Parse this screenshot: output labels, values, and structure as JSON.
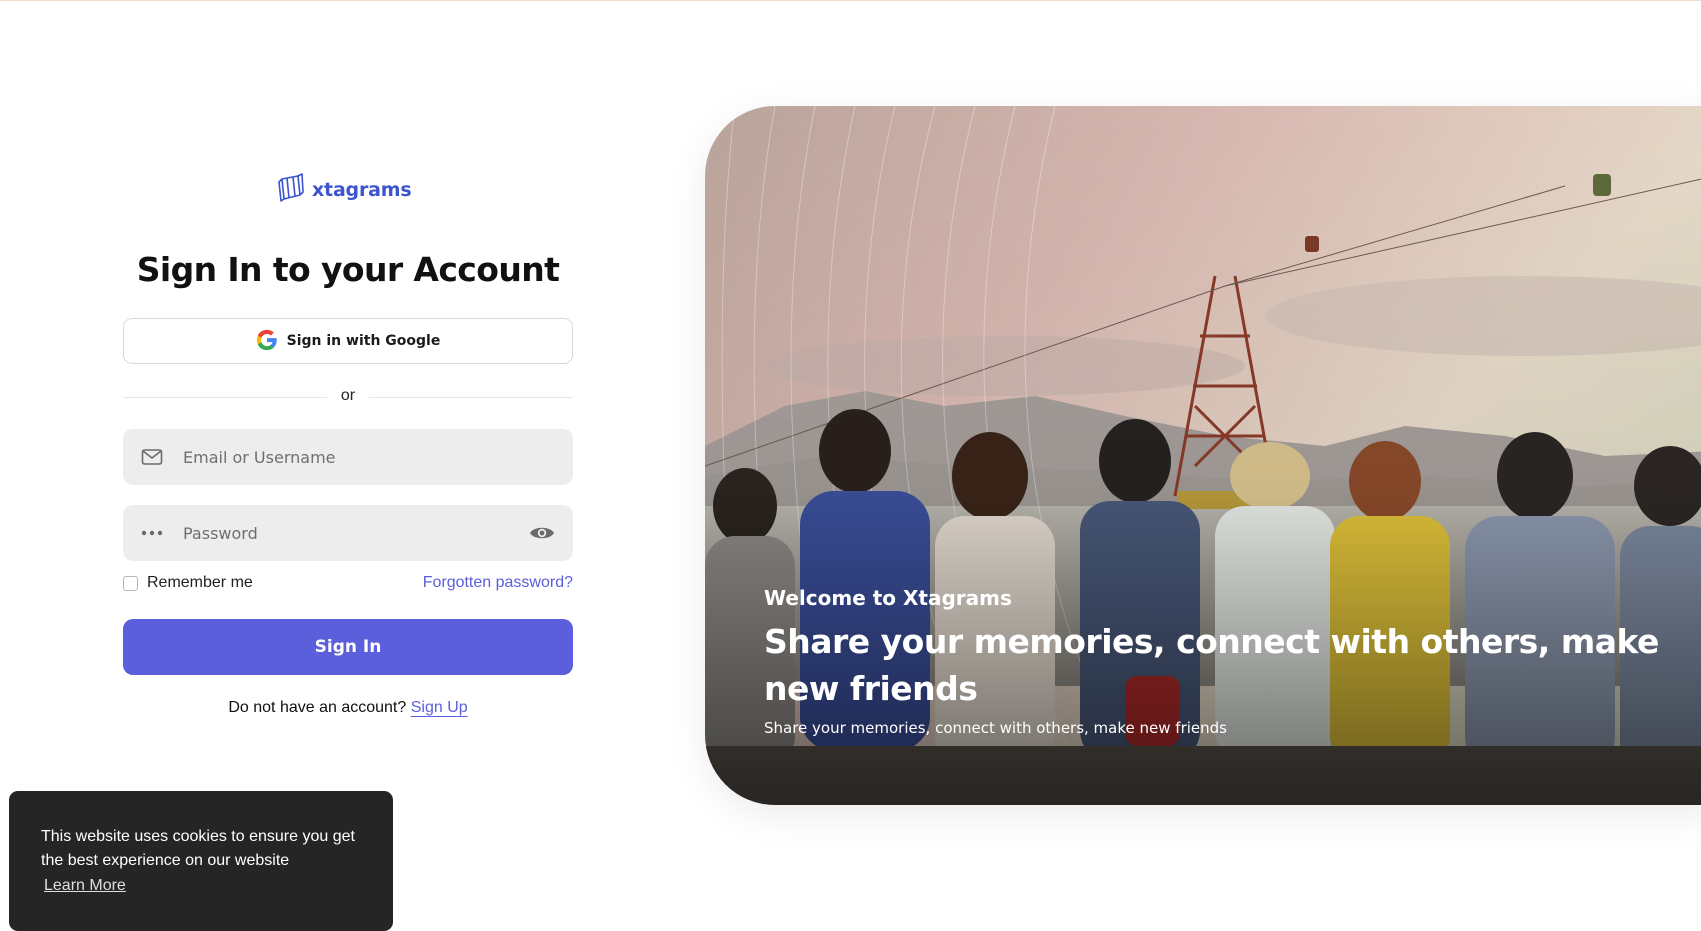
{
  "brand": {
    "name": "xtagrams",
    "logo_icon": "xtagrams-logo-icon"
  },
  "signin": {
    "title": "Sign In to your Account",
    "google_label": "Sign in with Google",
    "divider_text": "or",
    "email_placeholder": "Email or Username",
    "password_placeholder": "Password",
    "remember_label": "Remember me",
    "forgot_label": "Forgotten password?",
    "submit_label": "Sign In",
    "no_account_text": "Do not have an account?",
    "signup_label": "Sign Up"
  },
  "hero": {
    "welcome": "Welcome to Xtagrams",
    "headline": "Share your memories, connect with others, make new friends",
    "subline": "Share your memories, connect with others, make new friends"
  },
  "cookie": {
    "message": "This website uses cookies to ensure you get the best experience on our website",
    "link_label": "Learn More"
  },
  "colors": {
    "accent": "#5b5fdc",
    "brand": "#3d54cf",
    "field_bg": "#ededed",
    "cookie_bg": "#252525"
  },
  "icons": [
    "xtagrams-logo-icon",
    "google-icon",
    "mail-icon",
    "password-dots-icon",
    "eye-icon"
  ]
}
